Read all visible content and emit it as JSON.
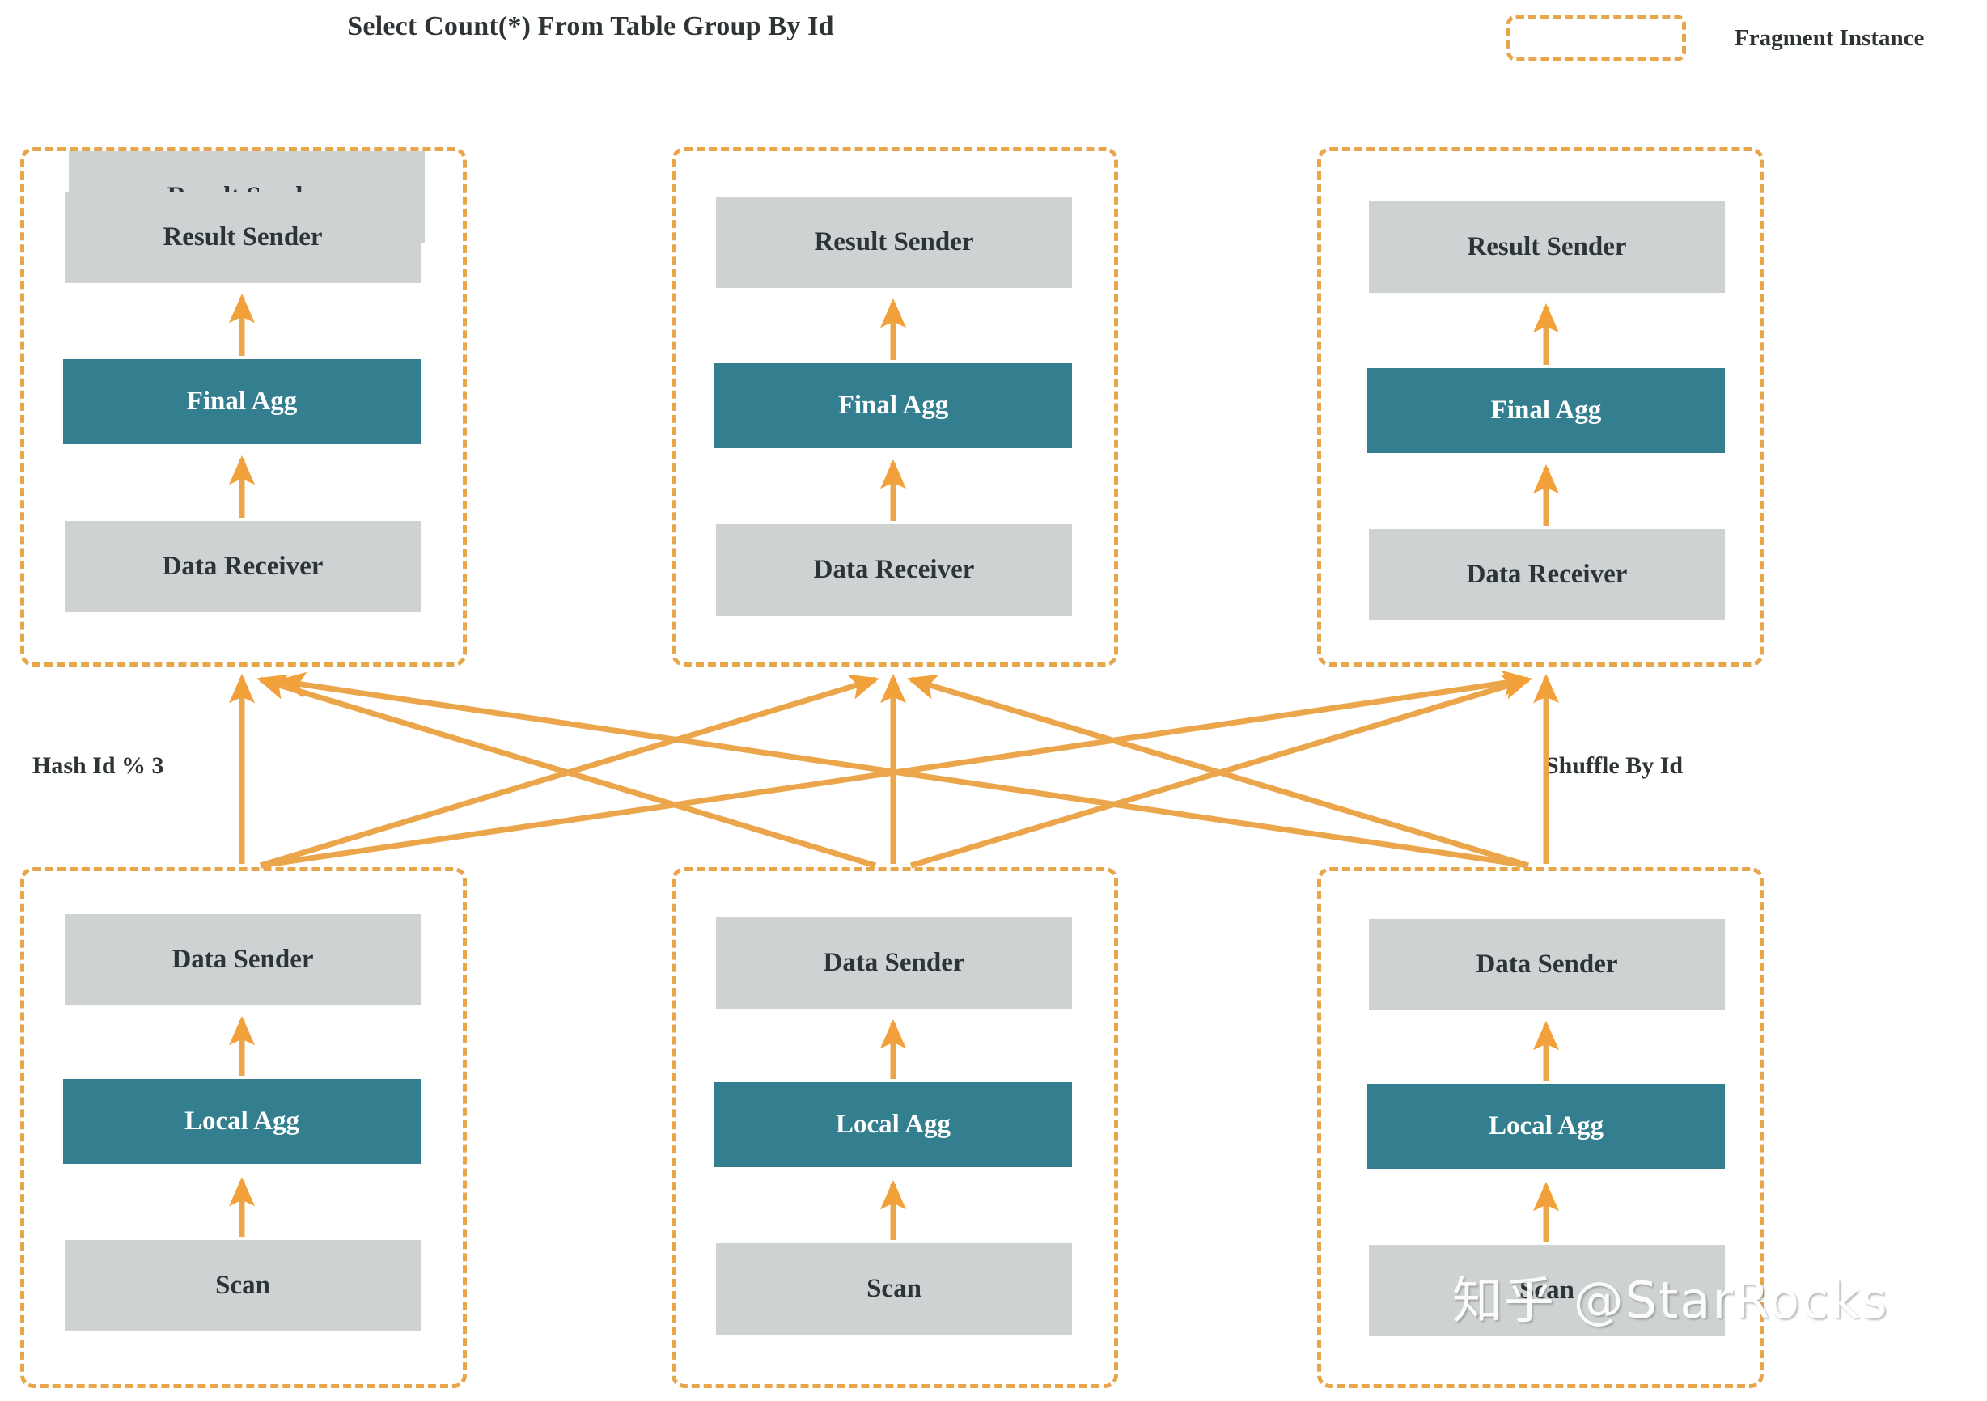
{
  "title": "Select Count(*) From Table Group By Id",
  "legend": {
    "swatch_icon": "dashed-rectangle-icon",
    "label": "Fragment Instance"
  },
  "colors": {
    "fragment_border": "#e8a64a",
    "arrow": "#e8a64a",
    "operator_gray": "#ced2d2",
    "operator_teal": "#337f8f",
    "text_dark": "#2e3436",
    "text_light": "#ffffff",
    "background": "#ffffff"
  },
  "edge_labels": {
    "left": "Hash Id % 3",
    "right": "Shuffle By Id"
  },
  "watermark": "知乎 @StarRocks",
  "top_fragments": [
    {
      "name": "fragment-instance-top-1",
      "operators": [
        {
          "label": "Result Sender",
          "style": "gray"
        },
        {
          "label": "Final Agg",
          "style": "teal"
        },
        {
          "label": "Data Receiver",
          "style": "gray"
        }
      ]
    },
    {
      "name": "fragment-instance-top-2",
      "operators": [
        {
          "label": "Result Sender",
          "style": "gray"
        },
        {
          "label": "Final Agg",
          "style": "teal"
        },
        {
          "label": "Data Receiver",
          "style": "gray"
        }
      ]
    },
    {
      "name": "fragment-instance-top-3",
      "operators": [
        {
          "label": "Result Sender",
          "style": "gray"
        },
        {
          "label": "Final Agg",
          "style": "teal"
        },
        {
          "label": "Data Receiver",
          "style": "gray"
        }
      ]
    }
  ],
  "bottom_fragments": [
    {
      "name": "fragment-instance-bottom-1",
      "operators": [
        {
          "label": "Data Sender",
          "style": "gray"
        },
        {
          "label": "Local Agg",
          "style": "teal"
        },
        {
          "label": "Scan",
          "style": "gray"
        }
      ]
    },
    {
      "name": "fragment-instance-bottom-2",
      "operators": [
        {
          "label": "Data Sender",
          "style": "gray"
        },
        {
          "label": "Local Agg",
          "style": "teal"
        },
        {
          "label": "Scan",
          "style": "gray"
        }
      ]
    },
    {
      "name": "fragment-instance-bottom-3",
      "operators": [
        {
          "label": "Data Sender",
          "style": "gray"
        },
        {
          "label": "Local Agg",
          "style": "teal"
        },
        {
          "label": "Scan",
          "style": "gray"
        }
      ]
    }
  ],
  "shuffle": {
    "description": "All-to-all shuffle: each bottom Data Sender feeds every top Data Receiver",
    "edges": [
      {
        "from": 0,
        "to": 0
      },
      {
        "from": 0,
        "to": 1
      },
      {
        "from": 0,
        "to": 2
      },
      {
        "from": 1,
        "to": 0
      },
      {
        "from": 1,
        "to": 1
      },
      {
        "from": 1,
        "to": 2
      },
      {
        "from": 2,
        "to": 0
      },
      {
        "from": 2,
        "to": 1
      },
      {
        "from": 2,
        "to": 2
      }
    ]
  }
}
